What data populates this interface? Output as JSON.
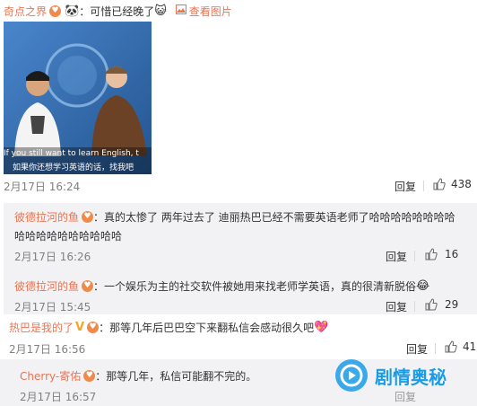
{
  "top": {
    "username": "奇点之界",
    "message": "：可惜已经晚了",
    "view_image": "查看图片",
    "emoji_panda": "🐼",
    "emoji_cat": "😺"
  },
  "main_comment": {
    "video_caption_en": "If you still want to learn English, t",
    "video_caption_zh": "如果你还想学习英语的话，找我吧",
    "time": "2月17日 16:24",
    "reply_label": "回复",
    "likes": "438"
  },
  "sub_replies": [
    {
      "username": "彼德拉河的鱼",
      "text_line1": "：真的太惨了 两年过去了 迪丽热巴已经不需要英语老师了哈哈哈哈哈哈哈哈",
      "text_line2": "哈哈哈哈哈哈哈哈哈哈",
      "time": "2月17日 16:26",
      "reply_label": "回复",
      "likes": "16"
    },
    {
      "username": "彼德拉河的鱼",
      "text_line1": "：一个娱乐为主的社交软件被她用来找老师学英语，真的很清新脱俗",
      "emoji": "😂",
      "time": "2月17日 15:45",
      "reply_label": "回复",
      "likes": "29"
    }
  ],
  "comment3": {
    "username": "热巴是我的了",
    "text": "：那等几年后巴巴空下来翻私信会感动很久吧",
    "emoji": "💖",
    "time": "2月17日 16:56",
    "reply_label": "回复",
    "likes": "41"
  },
  "comment3_reply": {
    "username": "Cherry-寄佑",
    "text": "：那等几年，私信可能翻不完的。",
    "time": "2月17日 16:57",
    "reply_label": "回复"
  },
  "watermark": {
    "text": "剧情奥秘"
  },
  "colors": {
    "username": "#eb7350",
    "time": "#808080",
    "reply_bg": "#f2f2f5",
    "watermark_blue": "#1a9be6"
  }
}
